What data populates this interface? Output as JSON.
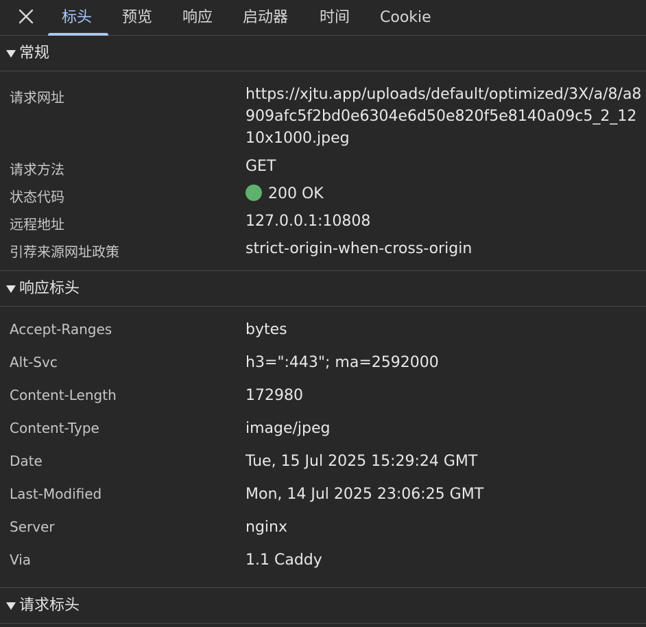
{
  "tabs": {
    "close_label": "✕",
    "items": [
      "标头",
      "预览",
      "响应",
      "启动器",
      "时间",
      "Cookie"
    ],
    "active": "标头"
  },
  "general": {
    "title": "常规",
    "rows": [
      {
        "key": "请求网址",
        "value": "https://xjtu.app/uploads/default/optimized/3X/a/8/a8909afc5f2bd0e6304e6d50e820f5e8140a09c5_2_1210x1000.jpeg"
      },
      {
        "key": "请求方法",
        "value": "GET"
      },
      {
        "key": "状态代码",
        "value": "200 OK"
      },
      {
        "key": "远程地址",
        "value": "127.0.0.1:10808"
      },
      {
        "key": "引荐来源网址政策",
        "value": "strict-origin-when-cross-origin"
      }
    ],
    "status_color": "#5fb16b"
  },
  "response_headers": {
    "title": "响应标头",
    "rows": [
      {
        "key": "Accept-Ranges",
        "value": "bytes"
      },
      {
        "key": "Alt-Svc",
        "value": "h3=\":443\"; ma=2592000"
      },
      {
        "key": "Content-Length",
        "value": "172980"
      },
      {
        "key": "Content-Type",
        "value": "image/jpeg"
      },
      {
        "key": "Date",
        "value": "Tue, 15 Jul 2025 15:29:24 GMT"
      },
      {
        "key": "Last-Modified",
        "value": "Mon, 14 Jul 2025 23:06:25 GMT"
      },
      {
        "key": "Server",
        "value": "nginx"
      },
      {
        "key": "Via",
        "value": "1.1 Caddy"
      }
    ]
  },
  "request_headers": {
    "title": "请求标头"
  },
  "colors": {
    "background": "#282828",
    "accent": "#a8c7fa",
    "divider": "#4a4a4a"
  }
}
